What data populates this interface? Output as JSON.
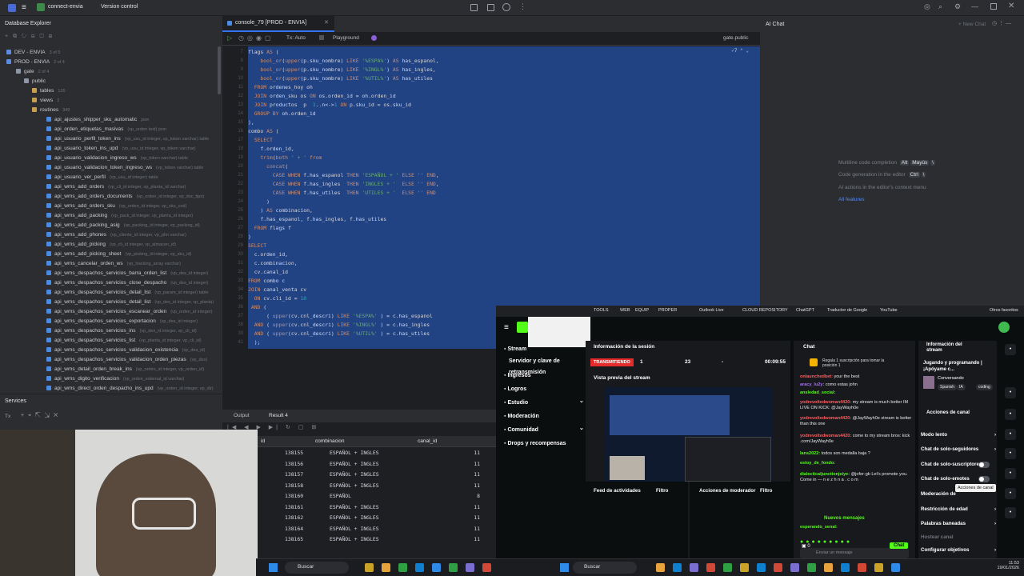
{
  "titlebar": {
    "project": "connect-envia",
    "vcs": "Version control"
  },
  "db_panel": {
    "title": "Database Explorer",
    "tree": [
      {
        "label": "DEV - ENVIA",
        "sub": "3 of 5",
        "indent": 8,
        "color": "#5e8ae0"
      },
      {
        "label": "PROD - ENVIA",
        "sub": "2 of 4",
        "indent": 8,
        "color": "#5e8ae0"
      },
      {
        "label": "gate",
        "sub": "2 of 4",
        "indent": 20,
        "color": "#8d97a5"
      },
      {
        "label": "public",
        "sub": "",
        "indent": 30,
        "color": "#8d97a5"
      },
      {
        "label": "tables",
        "sub": "126",
        "indent": 40,
        "color": "#c6a04d"
      },
      {
        "label": "views",
        "sub": "2",
        "indent": 40,
        "color": "#c6a04d"
      },
      {
        "label": "routines",
        "sub": "349",
        "indent": 40,
        "color": "#c6a04d"
      },
      {
        "label": "api_ajustes_shipper_sku_automatic",
        "sub": "json",
        "indent": 58,
        "color": "#4a8be6"
      },
      {
        "label": "api_orden_etiquetas_masivas",
        "sub": "(vp_orden text) json",
        "indent": 58,
        "color": "#4a8be6"
      },
      {
        "label": "api_usuario_perfil_token_ins",
        "sub": "(vp_usu_id integer, vp_token varchar) table",
        "indent": 58,
        "color": "#4a8be6"
      },
      {
        "label": "api_usuario_token_ins_upd",
        "sub": "(vp_usu_id integer, vp_token varchar)",
        "indent": 58,
        "color": "#4a8be6"
      },
      {
        "label": "api_usuario_validacion_ingreso_ws",
        "sub": "(vp_token varchar) table",
        "indent": 58,
        "color": "#4a8be6"
      },
      {
        "label": "api_usuario_validacion_token_ingreso_ws",
        "sub": "(vp_token varchar) table",
        "indent": 58,
        "color": "#4a8be6"
      },
      {
        "label": "api_usuario_ver_perfil",
        "sub": "(vp_usu_id integer) table",
        "indent": 58,
        "color": "#4a8be6"
      },
      {
        "label": "api_wms_add_orders",
        "sub": "(vp_cli_id integer, vp_planta_id varchar)",
        "indent": 58,
        "color": "#4a8be6"
      },
      {
        "label": "api_wms_add_orders_documents",
        "sub": "(vp_orden_id integer, vp_doc_tipo)",
        "indent": 58,
        "color": "#4a8be6"
      },
      {
        "label": "api_wms_add_orders_sku",
        "sub": "(vp_orden_id integer, vp_sku_cod)",
        "indent": 58,
        "color": "#4a8be6"
      },
      {
        "label": "api_wms_add_packing",
        "sub": "(vp_pack_id integer, vp_planta_id integer)",
        "indent": 58,
        "color": "#4a8be6"
      },
      {
        "label": "api_wms_add_packing_asig",
        "sub": "(vp_packing_id integer, vp_packing_id)",
        "indent": 58,
        "color": "#4a8be6"
      },
      {
        "label": "api_wms_add_phones",
        "sub": "(vp_cliente_id integer, vp_phn varchar)",
        "indent": 58,
        "color": "#4a8be6"
      },
      {
        "label": "api_wms_add_picking",
        "sub": "(vp_cli_id integer, vp_almacen_id)",
        "indent": 58,
        "color": "#4a8be6"
      },
      {
        "label": "api_wms_add_picking_sheet",
        "sub": "(vp_picking_id integer, vp_sku_id)",
        "indent": 58,
        "color": "#4a8be6"
      },
      {
        "label": "api_wms_cancelar_orden_ws",
        "sub": "(vp_tracking_array varchar)",
        "indent": 58,
        "color": "#4a8be6"
      },
      {
        "label": "api_wms_despachos_servicios_barra_orden_list",
        "sub": "(vp_des_id integer)",
        "indent": 58,
        "color": "#4a8be6"
      },
      {
        "label": "api_wms_despachos_servicios_close_despacho",
        "sub": "(vp_des_id integer)",
        "indent": 58,
        "color": "#4a8be6"
      },
      {
        "label": "api_wms_despachos_servicios_detail_list",
        "sub": "(vp_param_id integer) table",
        "indent": 58,
        "color": "#4a8be6"
      },
      {
        "label": "api_wms_despachos_servicios_detail_list",
        "sub": "(vp_des_id integer, vp_planta)",
        "indent": 58,
        "color": "#4a8be6"
      },
      {
        "label": "api_wms_despachos_servicios_escanear_orden",
        "sub": "(vp_orden_id integer)",
        "indent": 58,
        "color": "#4a8be6"
      },
      {
        "label": "api_wms_despachos_servicios_exportacion",
        "sub": "(vp_des_id integer)",
        "indent": 58,
        "color": "#4a8be6"
      },
      {
        "label": "api_wms_despachos_servicios_ins",
        "sub": "(vp_des_id integer, vp_cli_id)",
        "indent": 58,
        "color": "#4a8be6"
      },
      {
        "label": "api_wms_despachos_servicios_list",
        "sub": "(vp_planta_id integer, vp_cli_id)",
        "indent": 58,
        "color": "#4a8be6"
      },
      {
        "label": "api_wms_despachos_servicios_validacion_existencia",
        "sub": "(vp_des_id)",
        "indent": 58,
        "color": "#4a8be6"
      },
      {
        "label": "api_wms_despachos_servicios_validacion_orden_piezas",
        "sub": "(vp_des)",
        "indent": 58,
        "color": "#4a8be6"
      },
      {
        "label": "api_wms_detail_orden_break_ins",
        "sub": "(vp_orden_id integer, vp_orden_id)",
        "indent": 58,
        "color": "#4a8be6"
      },
      {
        "label": "api_wms_digito_verificacion",
        "sub": "(vp_orden_external_id varchar)",
        "indent": 58,
        "color": "#4a8be6"
      },
      {
        "label": "api_wms_direct_orden_despacho_ins_upd",
        "sub": "(vp_orden_id integer, vp_dir)",
        "indent": 58,
        "color": "#4a8be6"
      }
    ]
  },
  "editor": {
    "tab": "console_79 [PROD - ENVIA]",
    "tx": "Tx: Auto",
    "playground": "Playground",
    "schema": "gate.public",
    "warnings": "7",
    "selected_line": "41"
  },
  "code": [
    "flags AS (",
    "    bool_or(upper(p.sku_nombre) LIKE '%ESPA%') AS has_espanol,",
    "    bool_or(upper(p.sku_nombre) LIKE '%INGL%') AS has_ingles,",
    "    bool_or(upper(p.sku_nombre) LIKE '%UTIL%') AS has_utiles",
    "  FROM ordenes_hoy oh",
    "  JOIN orden_sku os ON os.orden_id = oh.orden_id",
    "  JOIN productos  p  1..n<->1 ON p.sku_id = os.sku_id",
    "  GROUP BY oh.orden_id",
    "),",
    "combo AS (",
    "  SELECT",
    "    f.orden_id,",
    "    trim(both ' + ' from",
    "      concat(",
    "        CASE WHEN f.has_espanol THEN 'ESPAÑOL + ' ELSE '' END,",
    "        CASE WHEN f.has_ingles  THEN 'INGLES + '  ELSE '' END,",
    "        CASE WHEN f.has_utiles  THEN 'UTILES + '  ELSE '' END",
    "      )",
    "    ) AS combinacion,",
    "    f.has_espanol, f.has_ingles, f.has_utiles",
    "  FROM flags f",
    ")",
    "SELECT",
    "  c.orden_id,",
    "  c.combinacion,",
    "  cv.canal_id",
    "FROM combo c",
    "JOIN canal_venta cv",
    "  ON cv.cli_id = 10",
    " AND (",
    "      ( upper(cv.cnl_descri) LIKE '%ESPA%' ) = c.has_espanol",
    "  AND ( upper(cv.cnl_descri) LIKE '%INGL%' ) = c.has_ingles",
    "  AND ( upper(cv.cnl_descri) LIKE '%UTIL%' ) = c.has_utiles",
    "  );"
  ],
  "ai_chat": {
    "title": "AI Chat",
    "new_chat": "+ New Chat",
    "hint1": "Multiline code completion",
    "hint1_key1": "Alt",
    "hint1_key2": "Mayús",
    "hint1_key3": "\\",
    "hint2": "Code generation in the editor",
    "hint2_key1": "Ctrl",
    "hint2_key2": "\\",
    "hint3": "AI actions in the editor's context menu",
    "hint4": "All features"
  },
  "services": {
    "title": "Services",
    "tx": "Tx",
    "db": "Database"
  },
  "results": {
    "tab_output": "Output",
    "tab_result": "Result 4",
    "col1": "id",
    "col2": "combinacion",
    "col3": "canal_id",
    "rows": [
      [
        "138155",
        "ESPAÑOL + INGLES",
        "11"
      ],
      [
        "138156",
        "ESPAÑOL + INGLES",
        "11"
      ],
      [
        "138157",
        "ESPAÑOL + INGLES",
        "11"
      ],
      [
        "138158",
        "ESPAÑOL + INGLES",
        "11"
      ],
      [
        "138160",
        "ESPAÑOL",
        "8"
      ],
      [
        "138161",
        "ESPAÑOL + INGLES",
        "11"
      ],
      [
        "138162",
        "ESPAÑOL + INGLES",
        "11"
      ],
      [
        "138164",
        "ESPAÑOL + INGLES",
        "11"
      ],
      [
        "138165",
        "ESPAÑOL + INGLES",
        "11"
      ]
    ]
  },
  "bookmarks": [
    "TOOLS",
    "WEB",
    "EQUIP",
    "PROPER",
    "Outlook Live",
    "CLOUD REPOSITORY",
    "ChatGPT",
    "Traductor de Google",
    "YouTube",
    "Otros favoritos"
  ],
  "kick": {
    "nav": [
      "Stream",
      "Servidor y clave de retransmisión",
      "Ingresos",
      "Logros",
      "Estudio",
      "Moderación",
      "Comunidad",
      "Drops y recompensas"
    ],
    "session_title": "Información de la sesión",
    "live": "TRANSMITIENDO",
    "viewers": "1",
    "followers": "23",
    "dash": "-",
    "timer": "00:09:55",
    "preview_title": "Vista previa del stream",
    "activity": "Feed de actividades",
    "filter": "Filtro",
    "mod_actions": "Acciones de moderador",
    "chat_title": "Chat",
    "sub_notice": "Regala 1 suscripción para tomar la posición 1",
    "chat": [
      {
        "user": "onlaunchedbet:",
        "msg": "your the best",
        "color": "#ff5c5c"
      },
      {
        "user": "aracy_lu2y:",
        "msg": "como estas john",
        "color": "#a970ff"
      },
      {
        "user": "ansledad_social:",
        "msg": "",
        "color": "#53fc18"
      },
      {
        "user": "yodrevoltedwoman4420:",
        "msg": "my stream is much better IM LIVE ON KICK: @JayWayh0e",
        "color": "#ff5c5c"
      },
      {
        "user": "yodrevoltedwoman4420:",
        "msg": "@JayWayh0e stream is better than this one",
        "color": "#ff5c5c"
      },
      {
        "user": "yodrevoltedwoman4420:",
        "msg": "come to my stream bros: kick .com/JayWayh0e",
        "color": "#ff5c5c"
      },
      {
        "user": "lans2022:",
        "msg": "todos son medalla baja ?",
        "color": "#53fc18"
      },
      {
        "user": "estoy_de_fondo:",
        "msg": "",
        "color": "#53fc18"
      },
      {
        "user": "dialecticaljunctionjsiye:",
        "msg": "@jofer-gb Let's promote you. Come in — n e z h n a . c o m",
        "color": "#53fc18"
      }
    ],
    "new_messages": "Nuevos mensajes",
    "last_user": "esperando_senal:",
    "chat_placeholder": "Enviar un mensaje",
    "chat_count": "0",
    "chat_btn": "Chat",
    "info_title": "Información del stream",
    "stream_title": "Jugando y programando | ¡Apóyame c...",
    "category": "Conversando",
    "tags": [
      "Spanish",
      "IA",
      "coding"
    ],
    "channel_actions": "Acciones de canal",
    "tooltip": "Acciones de canal",
    "menu": [
      {
        "label": "Modo lento",
        "kind": "chevron"
      },
      {
        "label": "Chat de solo-seguidores",
        "kind": "chevron"
      },
      {
        "label": "Chat de solo-suscriptores",
        "kind": "toggle"
      },
      {
        "label": "Chat de solo-emotes",
        "kind": "toggle"
      },
      {
        "label": "Moderación de",
        "kind": "none"
      },
      {
        "label": "Restricción de edad",
        "kind": "chevron"
      },
      {
        "label": "Palabras baneadas",
        "kind": "chevron"
      },
      {
        "label": "Hostear canal",
        "kind": "none"
      },
      {
        "label": "Configurar objetivos",
        "kind": "chevron"
      }
    ]
  },
  "taskbar": {
    "search_left": "Buscar",
    "search_right": "Buscar",
    "time": "11:53",
    "date": "19/01/2026"
  }
}
